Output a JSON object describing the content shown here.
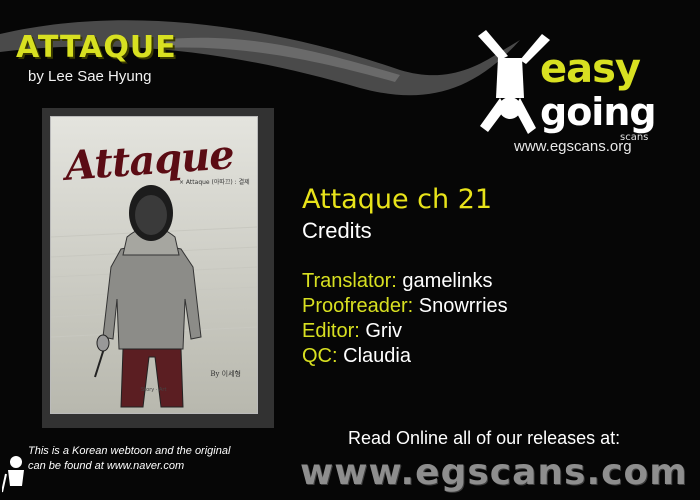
{
  "header": {
    "title": "ATTAQUE",
    "author": "by Lee Sae Hyung"
  },
  "cover": {
    "title": "Attaque",
    "subtitle": "× Attaque (아따끄) : 결제",
    "signature": "By 이세형",
    "credits_text": "Story · Art"
  },
  "logo": {
    "line1": "easy",
    "line2": "going",
    "line3": "scans",
    "url": "www.egscans.org",
    "accent_color": "#d8e021"
  },
  "release": {
    "chapter": "Attaque ch 21",
    "credits_heading": "Credits",
    "credits": [
      {
        "role": "Translator:",
        "name": "gamelinks"
      },
      {
        "role": "Proofreader:",
        "name": "Snowrries"
      },
      {
        "role": "Editor:",
        "name": "Griv"
      },
      {
        "role": "QC:",
        "name": "Claudia"
      }
    ]
  },
  "footer": {
    "read_online": "Read Online all of our releases at:",
    "site": "www.egscans.com",
    "note_line1": "This is a Korean webtoon and the original",
    "note_line2": "can be found at www.naver.com"
  },
  "colors": {
    "background": "#060606",
    "yellow": "#d8e021",
    "white": "#ffffff"
  }
}
